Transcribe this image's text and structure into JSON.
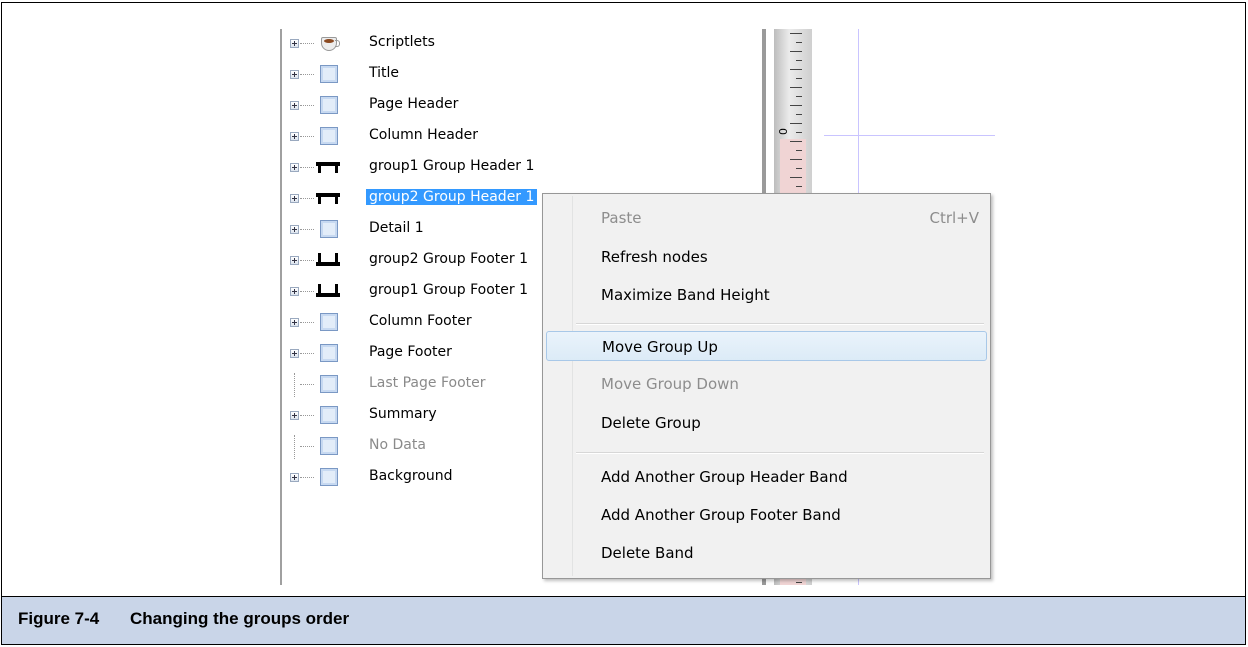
{
  "tree": {
    "nodes": [
      {
        "label": "Scriptlets",
        "icon": "scriptlet-cup-icon",
        "expandable": true,
        "disabled": false,
        "selected": false
      },
      {
        "label": "Title",
        "icon": "band-icon",
        "expandable": true,
        "disabled": false,
        "selected": false
      },
      {
        "label": "Page Header",
        "icon": "band-icon",
        "expandable": true,
        "disabled": false,
        "selected": false
      },
      {
        "label": "Column Header",
        "icon": "band-icon",
        "expandable": true,
        "disabled": false,
        "selected": false
      },
      {
        "label": "group1 Group Header 1",
        "icon": "group-header-icon",
        "expandable": true,
        "disabled": false,
        "selected": false
      },
      {
        "label": "group2 Group Header 1",
        "icon": "group-header-icon",
        "expandable": true,
        "disabled": false,
        "selected": true
      },
      {
        "label": "Detail 1",
        "icon": "band-icon",
        "expandable": true,
        "disabled": false,
        "selected": false
      },
      {
        "label": "group2 Group Footer 1",
        "icon": "group-footer-icon",
        "expandable": true,
        "disabled": false,
        "selected": false
      },
      {
        "label": "group1 Group Footer 1",
        "icon": "group-footer-icon",
        "expandable": true,
        "disabled": false,
        "selected": false
      },
      {
        "label": "Column Footer",
        "icon": "band-icon",
        "expandable": true,
        "disabled": false,
        "selected": false
      },
      {
        "label": "Page Footer",
        "icon": "band-icon",
        "expandable": true,
        "disabled": false,
        "selected": false
      },
      {
        "label": "Last Page Footer",
        "icon": "band-icon",
        "expandable": false,
        "disabled": true,
        "selected": false
      },
      {
        "label": "Summary",
        "icon": "band-icon",
        "expandable": true,
        "disabled": false,
        "selected": false
      },
      {
        "label": "No Data",
        "icon": "band-icon",
        "expandable": false,
        "disabled": true,
        "selected": false
      },
      {
        "label": "Background",
        "icon": "band-icon",
        "expandable": true,
        "disabled": false,
        "selected": false
      }
    ]
  },
  "ruler": {
    "zero_label": "0"
  },
  "context_menu": {
    "paste": {
      "label": "Paste",
      "shortcut": "Ctrl+V",
      "disabled": true
    },
    "refresh_nodes": {
      "label": "Refresh nodes"
    },
    "maximize_band_height": {
      "label": "Maximize Band Height"
    },
    "move_group_up": {
      "label": "Move Group Up",
      "hover": true
    },
    "move_group_down": {
      "label": "Move Group Down",
      "disabled": true
    },
    "delete_group": {
      "label": "Delete Group"
    },
    "add_group_header_band": {
      "label": "Add Another Group Header Band"
    },
    "add_group_footer_band": {
      "label": "Add Another Group Footer Band"
    },
    "delete_band": {
      "label": "Delete Band"
    }
  },
  "caption": {
    "number": "Figure 7-4",
    "title": "Changing the groups order"
  },
  "colors": {
    "selection": "#3399ff",
    "caption_bg": "#c9d5e8",
    "menu_hover": "#dcebf7"
  }
}
